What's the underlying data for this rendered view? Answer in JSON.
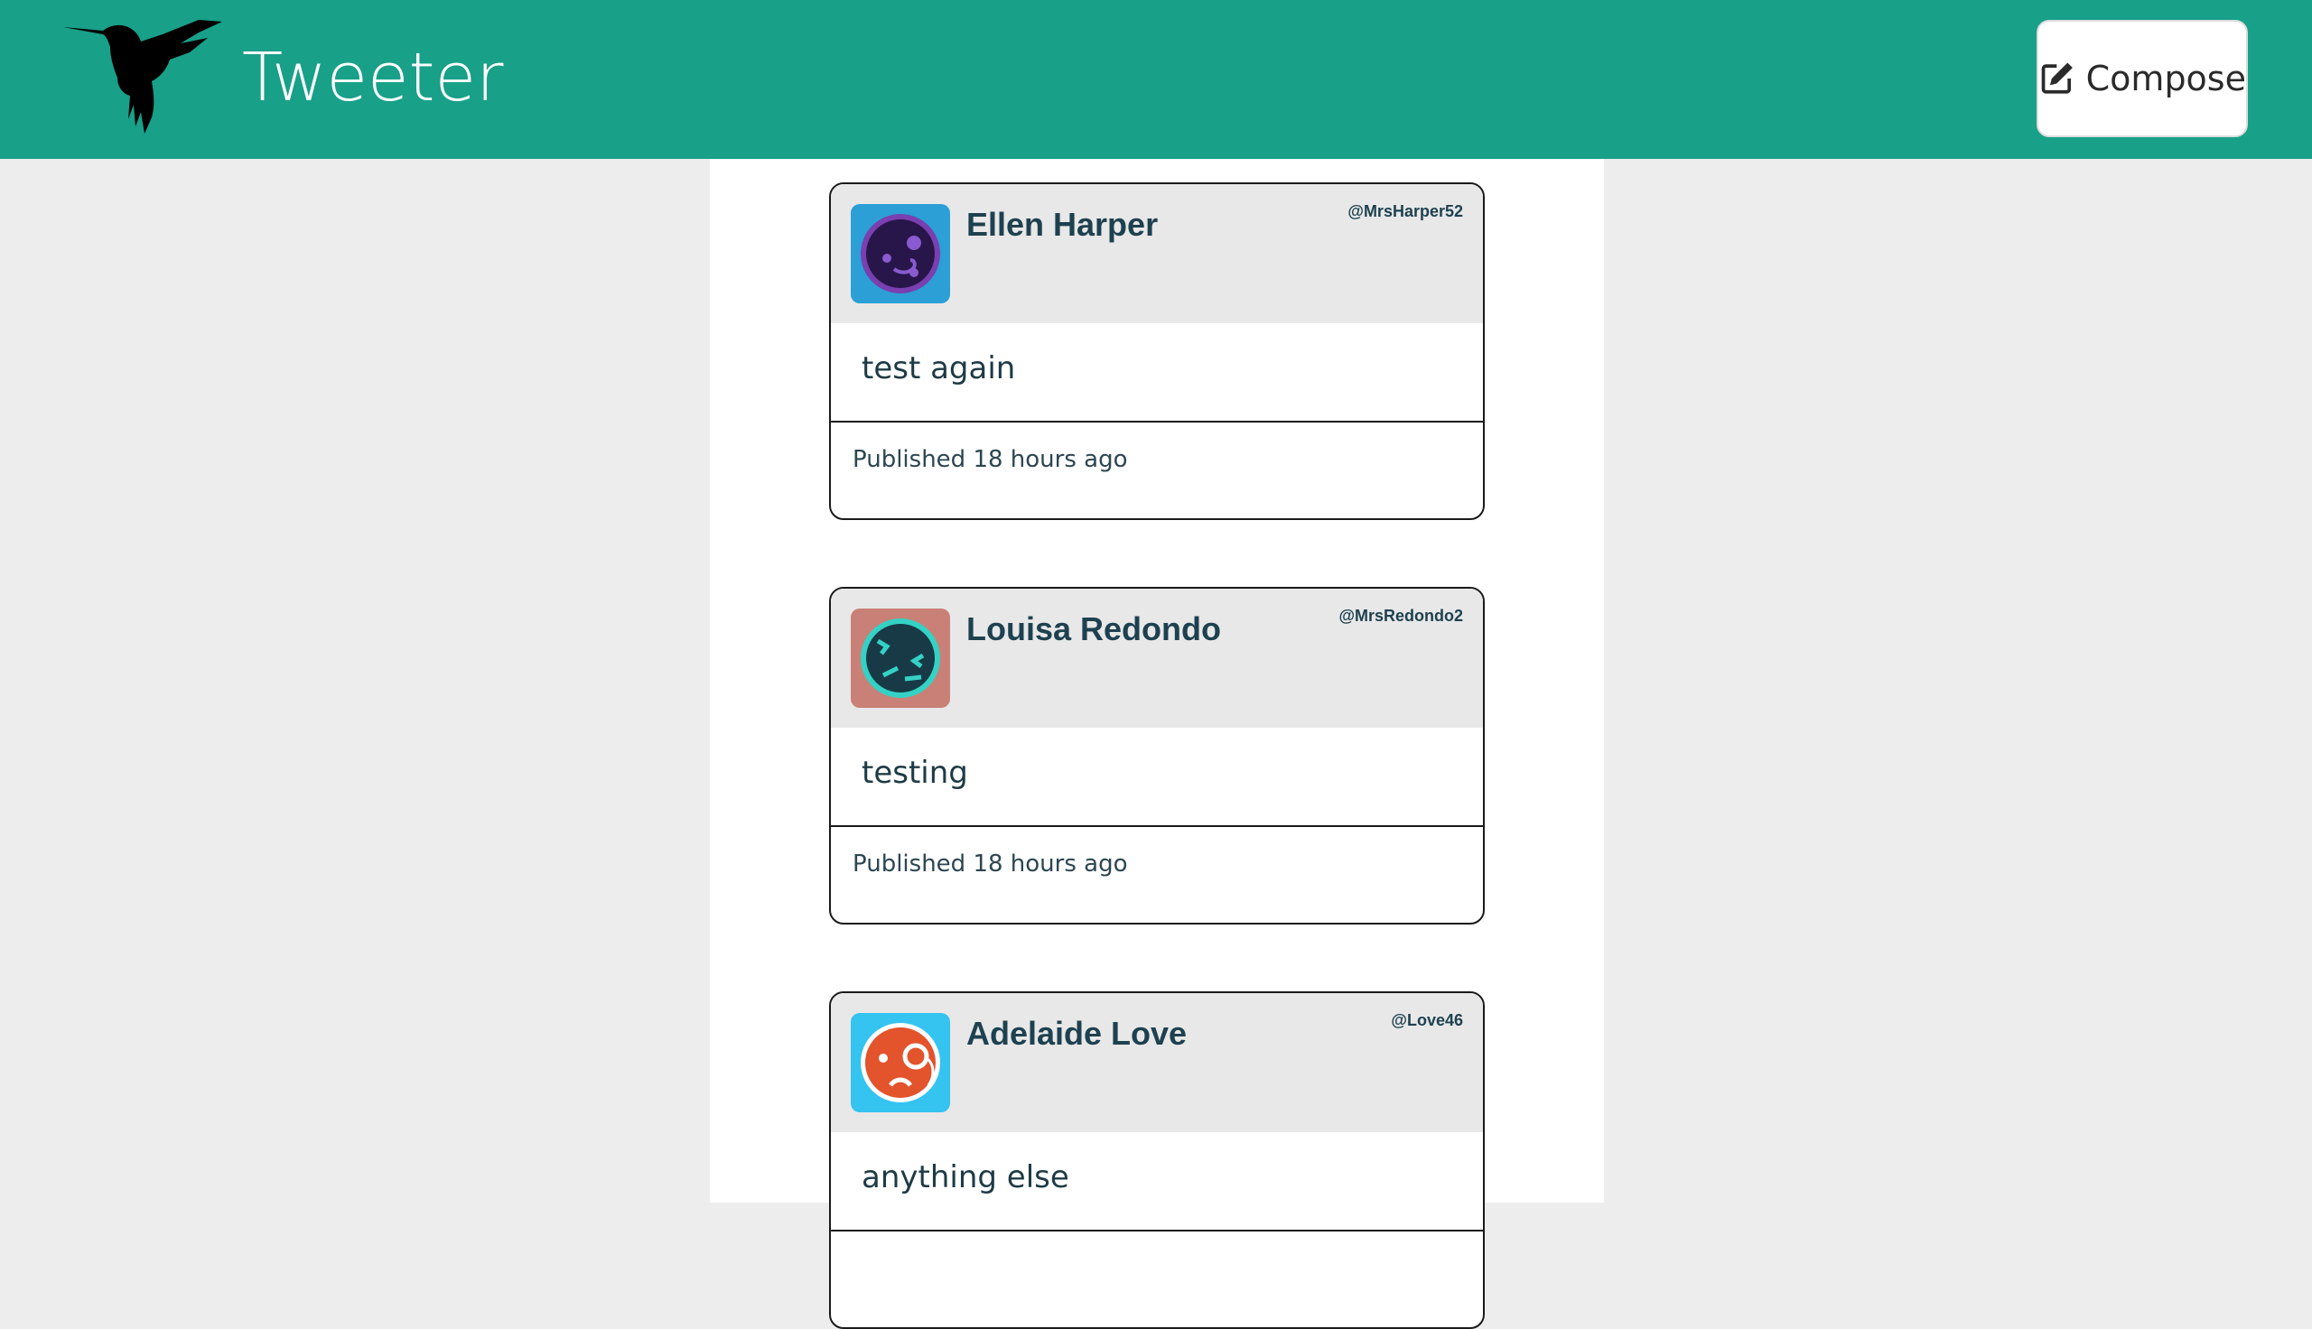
{
  "header": {
    "brand": "Tweeter",
    "compose_label": "Compose",
    "logo_icon": "hummingbird-icon",
    "compose_icon": "edit-icon",
    "background": "#18a089"
  },
  "tweets": [
    {
      "name": "Ellen Harper",
      "handle": "@MrsHarper52",
      "text": "test again",
      "published": "Published 18 hours ago",
      "avatar_icon": "robot-face-purple-icon",
      "avatar_bg": "#2b9fd6"
    },
    {
      "name": "Louisa Redondo",
      "handle": "@MrsRedondo2",
      "text": "testing",
      "published": "Published 18 hours ago",
      "avatar_icon": "squint-face-teal-icon",
      "avatar_bg": "#c98077"
    },
    {
      "name": "Adelaide Love",
      "handle": "@Love46",
      "text": "anything else",
      "published": "",
      "avatar_icon": "monocle-face-orange-icon",
      "avatar_bg": "#35c3ef"
    }
  ]
}
